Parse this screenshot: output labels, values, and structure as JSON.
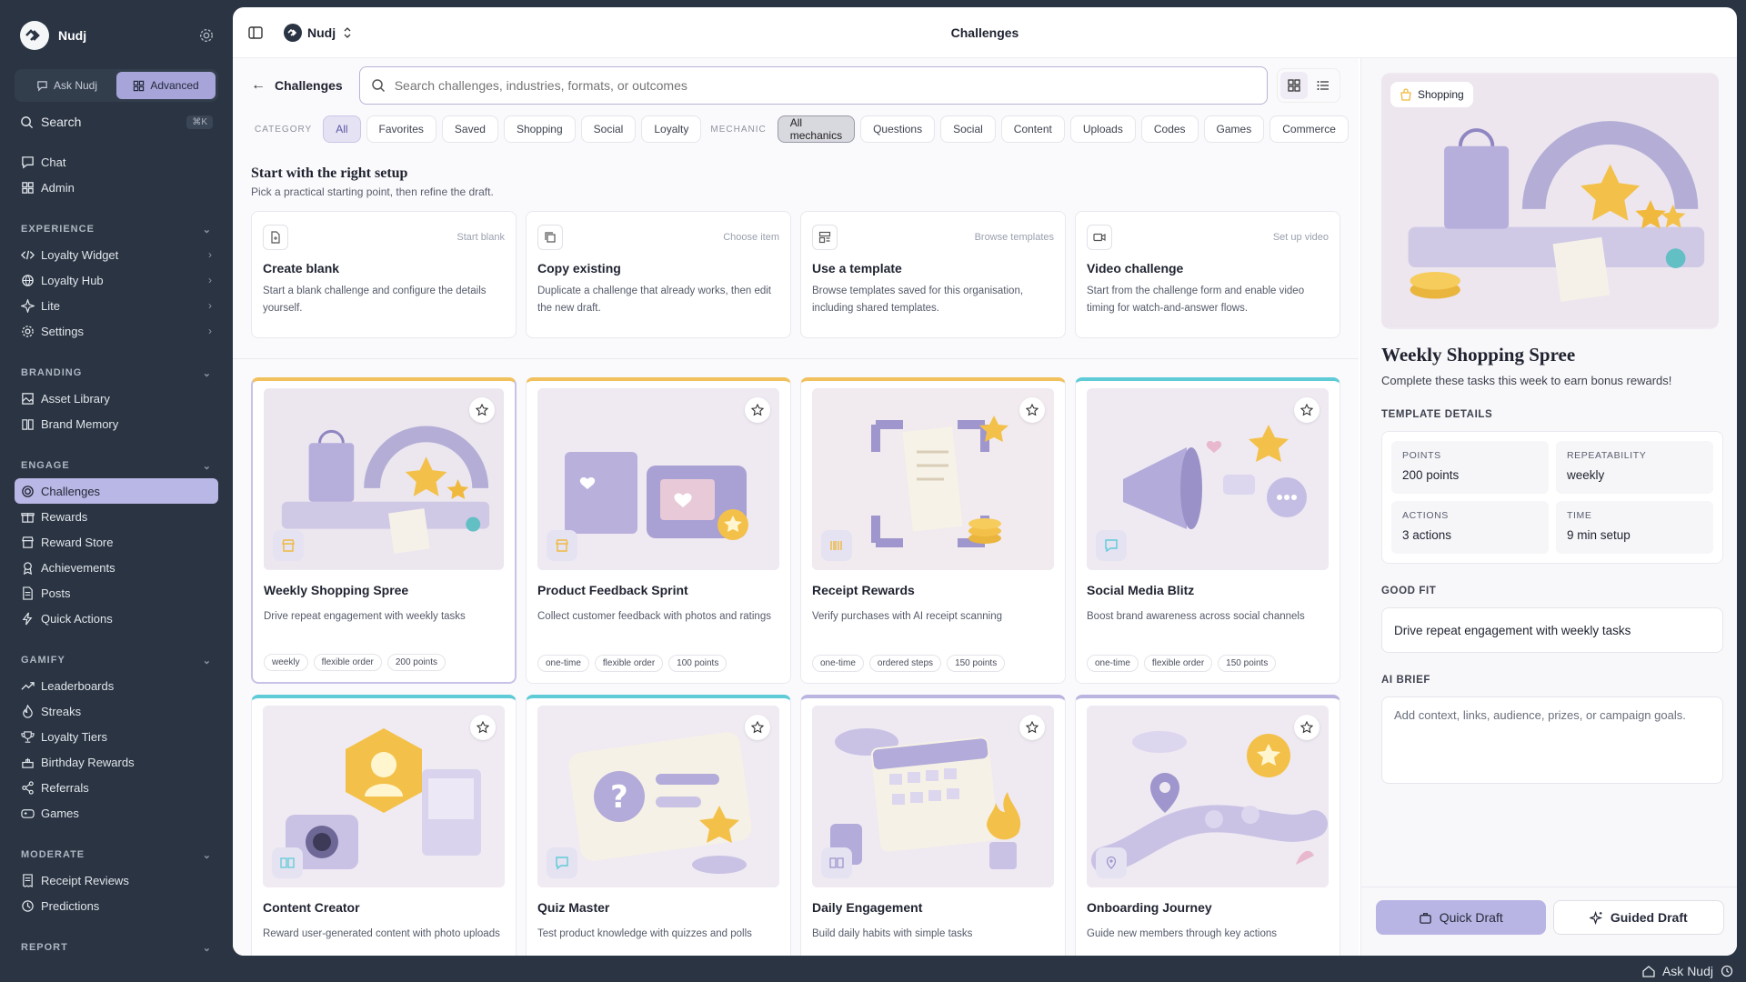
{
  "sidebar": {
    "brand": "Nudj",
    "modes": {
      "ask": "Ask Nudj",
      "advanced": "Advanced"
    },
    "search": {
      "label": "Search",
      "shortcut": "⌘K"
    },
    "top_items": [
      {
        "label": "Chat"
      },
      {
        "label": "Admin"
      }
    ],
    "sections": [
      {
        "title": "EXPERIENCE",
        "items": [
          {
            "label": "Loyalty Widget"
          },
          {
            "label": "Loyalty Hub"
          },
          {
            "label": "Lite"
          },
          {
            "label": "Settings"
          }
        ]
      },
      {
        "title": "BRANDING",
        "items": [
          {
            "label": "Asset Library"
          },
          {
            "label": "Brand Memory"
          }
        ]
      },
      {
        "title": "ENGAGE",
        "items": [
          {
            "label": "Challenges"
          },
          {
            "label": "Rewards"
          },
          {
            "label": "Reward Store"
          },
          {
            "label": "Achievements"
          },
          {
            "label": "Posts"
          },
          {
            "label": "Quick Actions"
          }
        ]
      },
      {
        "title": "GAMIFY",
        "items": [
          {
            "label": "Leaderboards"
          },
          {
            "label": "Streaks"
          },
          {
            "label": "Loyalty Tiers"
          },
          {
            "label": "Birthday Rewards"
          },
          {
            "label": "Referrals"
          },
          {
            "label": "Games"
          }
        ]
      },
      {
        "title": "MODERATE",
        "items": [
          {
            "label": "Receipt Reviews"
          },
          {
            "label": "Predictions"
          }
        ]
      },
      {
        "title": "REPORT",
        "items": []
      }
    ]
  },
  "topbar": {
    "org": "Nudj",
    "title": "Challenges"
  },
  "search": {
    "crumb": "Challenges",
    "placeholder": "Search challenges, industries, formats, or outcomes"
  },
  "filters": {
    "category_label": "CATEGORY",
    "categories": [
      "All",
      "Favorites",
      "Saved",
      "Shopping",
      "Social",
      "Loyalty"
    ],
    "mechanic_label": "MECHANIC",
    "mechanics": [
      "All mechanics",
      "Questions",
      "Social",
      "Content",
      "Uploads",
      "Codes",
      "Games",
      "Commerce"
    ]
  },
  "setup": {
    "title": "Start with the right setup",
    "subtitle": "Pick a practical starting point, then refine the draft.",
    "options": [
      {
        "title": "Create blank",
        "action": "Start blank",
        "desc": "Start a blank challenge and configure the details yourself."
      },
      {
        "title": "Copy existing",
        "action": "Choose item",
        "desc": "Duplicate a challenge that already works, then edit the new draft."
      },
      {
        "title": "Use a template",
        "action": "Browse templates",
        "desc": "Browse templates saved for this organisation, including shared templates."
      },
      {
        "title": "Video challenge",
        "action": "Set up video",
        "desc": "Start from the challenge form and enable video timing for watch-and-answer flows."
      }
    ]
  },
  "templates": [
    {
      "title": "Weekly Shopping Spree",
      "desc": "Drive repeat engagement with weekly tasks",
      "tags": [
        "weekly",
        "flexible order",
        "200 points"
      ],
      "accent": "#f1c15e"
    },
    {
      "title": "Product Feedback Sprint",
      "desc": "Collect customer feedback with photos and ratings",
      "tags": [
        "one-time",
        "flexible order",
        "100 points"
      ],
      "accent": "#f1c15e"
    },
    {
      "title": "Receipt Rewards",
      "desc": "Verify purchases with AI receipt scanning",
      "tags": [
        "one-time",
        "ordered steps",
        "150 points"
      ],
      "accent": "#f1c15e"
    },
    {
      "title": "Social Media Blitz",
      "desc": "Boost brand awareness across social channels",
      "tags": [
        "one-time",
        "flexible order",
        "150 points"
      ],
      "accent": "#5fcbd6"
    },
    {
      "title": "Content Creator",
      "desc": "Reward user-generated content with photo uploads",
      "tags": [],
      "accent": "#5fcbd6"
    },
    {
      "title": "Quiz Master",
      "desc": "Test product knowledge with quizzes and polls",
      "tags": [],
      "accent": "#5fcbd6"
    },
    {
      "title": "Daily Engagement",
      "desc": "Build daily habits with simple tasks",
      "tags": [],
      "accent": "#b9b5e0"
    },
    {
      "title": "Onboarding Journey",
      "desc": "Guide new members through key actions",
      "tags": [],
      "accent": "#b9b5e0"
    }
  ],
  "detail": {
    "badge": "Shopping",
    "title": "Weekly Shopping Spree",
    "subtitle": "Complete these tasks this week to earn bonus rewards!",
    "template_details_label": "TEMPLATE DETAILS",
    "stats": [
      {
        "label": "POINTS",
        "value": "200 points"
      },
      {
        "label": "REPEATABILITY",
        "value": "weekly"
      },
      {
        "label": "ACTIONS",
        "value": "3 actions"
      },
      {
        "label": "TIME",
        "value": "9 min setup"
      }
    ],
    "good_fit_label": "GOOD FIT",
    "good_fit": "Drive repeat engagement with weekly tasks",
    "ai_brief_label": "AI BRIEF",
    "ai_brief_placeholder": "Add context, links, audience, prizes, or campaign goals.",
    "quick_draft": "Quick Draft",
    "guided_draft": "Guided Draft"
  },
  "footer": {
    "ask": "Ask Nudj"
  }
}
